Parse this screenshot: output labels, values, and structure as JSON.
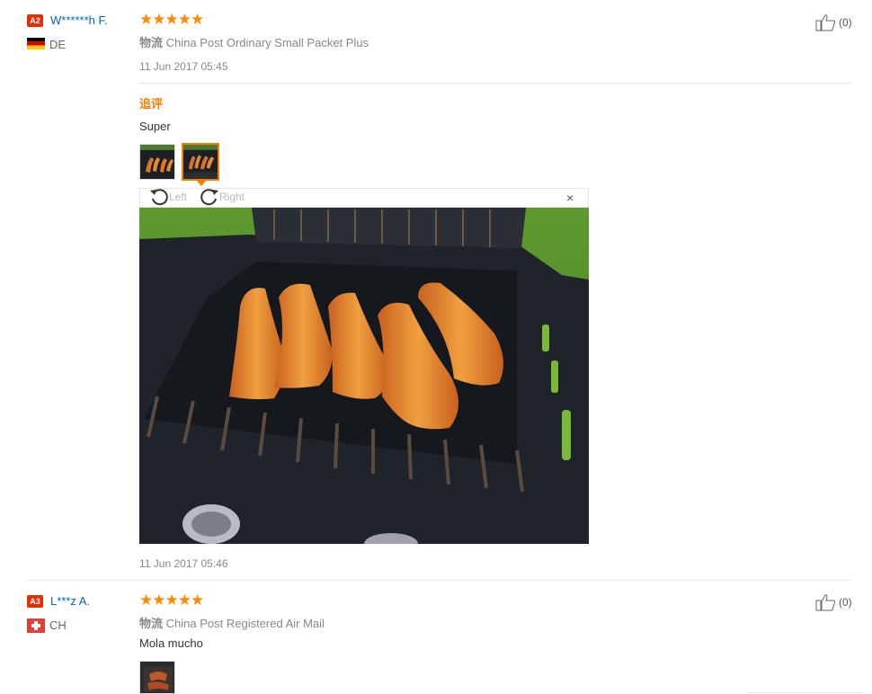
{
  "reviews": [
    {
      "level": "A2",
      "user": "W******h F.",
      "country": "DE",
      "stars": "★★★★★",
      "logistics_label": "物流",
      "logistics": "China Post Ordinary Small Packet Plus",
      "date": "11 Jun 2017 05:45",
      "likes": "(0)",
      "append_label": "追评",
      "append_text": "Super",
      "append_date": "11 Jun 2017 05:46",
      "viewer": {
        "left_label": "Left",
        "right_label": "Right",
        "close": "×"
      }
    },
    {
      "level": "A3",
      "user": "L***z A.",
      "country": "CH",
      "stars": "★★★★★",
      "logistics_label": "物流",
      "logistics": "China Post Registered Air Mail",
      "text": "Mola mucho",
      "likes": "(0)"
    }
  ],
  "colors": {
    "accent": "#f08000",
    "star": "#ff8a00",
    "user": "#0066c0",
    "level": "#e62e04"
  },
  "icons": [
    "thumbs-up-icon",
    "rotate-left-icon",
    "rotate-right-icon",
    "close-icon",
    "flag-de-icon",
    "flag-ch-icon"
  ]
}
